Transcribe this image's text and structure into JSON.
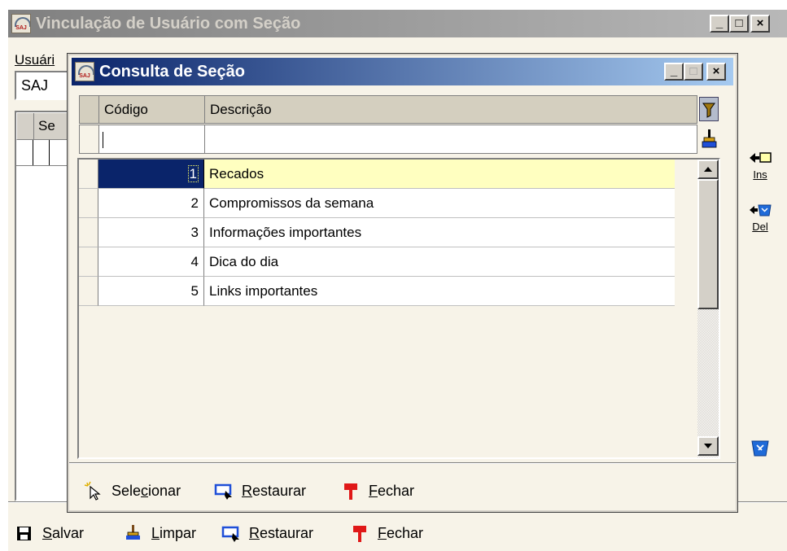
{
  "parent": {
    "title": "Vinculação de Usuário com Seção",
    "app_icon_text": "SAJ",
    "user_label": "Usuári",
    "user_value": "SAJ",
    "grid_header": "Se",
    "side_ins": "Ins",
    "side_del": "Del",
    "buttons": {
      "minimize": "_",
      "maximize": "□",
      "close": "×"
    },
    "toolbar": [
      {
        "pre": "",
        "u": "S",
        "post": "alvar",
        "icon": "floppy-icon"
      },
      {
        "pre": "",
        "u": "L",
        "post": "impar",
        "icon": "broom-icon"
      },
      {
        "pre": "",
        "u": "R",
        "post": "estaurar",
        "icon": "restore-icon"
      },
      {
        "pre": "",
        "u": "F",
        "post": "echar",
        "icon": "flag-icon"
      }
    ]
  },
  "dialog": {
    "title": "Consulta de Seção",
    "app_icon_text": "SAJ",
    "columns": [
      "Código",
      "Descrição"
    ],
    "filter_value": "",
    "rows": [
      {
        "codigo": "1",
        "descricao": "Recados"
      },
      {
        "codigo": "2",
        "descricao": "Compromissos da semana"
      },
      {
        "codigo": "3",
        "descricao": "Informações importantes"
      },
      {
        "codigo": "4",
        "descricao": "Dica do dia"
      },
      {
        "codigo": "5",
        "descricao": "Links importantes"
      }
    ],
    "selected_row_index": 0,
    "toolbar": [
      {
        "pre": "Sele",
        "u": "c",
        "post": "ionar",
        "icon": "cursor-sparkle-icon"
      },
      {
        "pre": "",
        "u": "R",
        "post": "estaurar",
        "icon": "restore-icon"
      },
      {
        "pre": "",
        "u": "F",
        "post": "echar",
        "icon": "flag-icon"
      }
    ]
  },
  "colors": {
    "active_title_start": "#0a246a",
    "active_title_end": "#a6caf0",
    "selection": "#0a246a",
    "highlight_row": "#ffffc0",
    "panel_bg": "#f7f3e8"
  }
}
